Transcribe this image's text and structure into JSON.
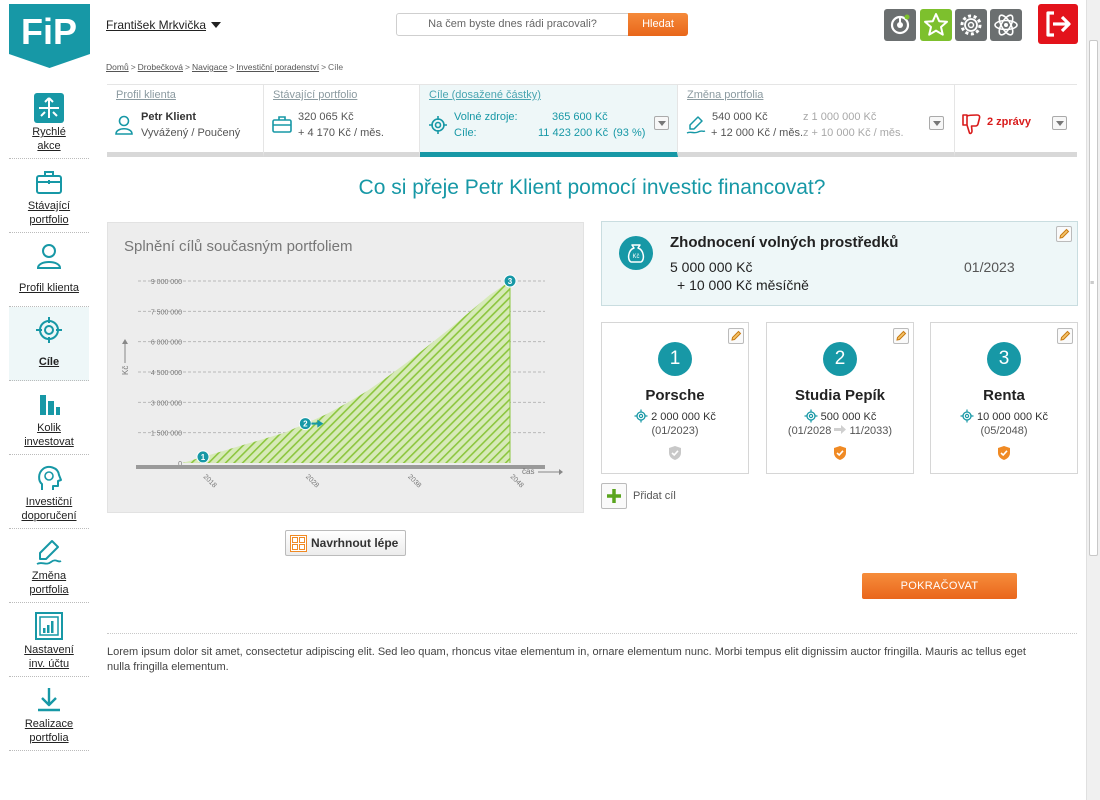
{
  "logo": {
    "text": "FiP"
  },
  "user": {
    "name": "František Mrkvička"
  },
  "search": {
    "placeholder": "Na čem byste dnes rádi pracovali?",
    "button_label": "Hledat"
  },
  "toolbar": {
    "icons": [
      "badge-icon",
      "star-icon",
      "gear-icon",
      "atom-icon",
      "logout-icon"
    ]
  },
  "breadcrumb": {
    "items": [
      "Domů",
      "Drobečková",
      "Navigace",
      "Investiční poradenství"
    ],
    "current": "Cíle",
    "separator": ">"
  },
  "sidebar": {
    "items": [
      {
        "label": "Rychlé akce",
        "line1": "Rychlé",
        "line2": "akce"
      },
      {
        "label": "Stávající portfolio",
        "line1": "Stávající",
        "line2": "portfolio"
      },
      {
        "label": "Profil klienta",
        "line1": "Profil klienta",
        "line2": ""
      },
      {
        "label": "Cíle",
        "line1": "Cíle",
        "line2": "",
        "active": true
      },
      {
        "label": "Kolik investovat",
        "line1": "Kolik",
        "line2": "investovat"
      },
      {
        "label": "Investiční doporučení",
        "line1": "Investiční",
        "line2": "doporučení"
      },
      {
        "label": "Změna portfolia",
        "line1": "Změna",
        "line2": "portfolia"
      },
      {
        "label": "Nastavení inv. účtu",
        "line1": "Nastavení",
        "line2": "inv. účtu"
      },
      {
        "label": "Realizace portfolia",
        "line1": "Realizace",
        "line2": "portfolia"
      }
    ]
  },
  "tabs": {
    "profile": {
      "title": "Profil klienta",
      "name": "Petr Klient",
      "profile": "Vyvážený / Poučený"
    },
    "portfolio": {
      "title": "Stávající portfolio",
      "amount": "320 065 Kč",
      "monthly": "+ 4 170 Kč / měs."
    },
    "goals": {
      "title": "Cíle (dosažené částky)",
      "free_label": "Volné zdroje:",
      "free_value": "365 600 Kč",
      "goals_label": "Cíle:",
      "goals_value": "11 423 200 Kč",
      "goals_pct": "(93 %)"
    },
    "change": {
      "title": "Změna portfolia",
      "amount": "540 000 Kč",
      "amount_of": "z 1 000 000 Kč",
      "monthly": "+ 12 000 Kč / měs.",
      "monthly_of": "z  + 10 000 Kč / měs."
    },
    "messages": {
      "label": "2 zprávy"
    }
  },
  "page_title": "Co si přeje Petr Klient pomocí investic financovat?",
  "chart_data": {
    "type": "area",
    "title": "Splnění cílů současným portfoliem",
    "xlabel": "čas",
    "ylabel": "Kč",
    "x_ticks": [
      "2018",
      "2028",
      "2038",
      "2048"
    ],
    "y_ticks": [
      "0",
      "1 500 000",
      "3 000 000",
      "4 500 000",
      "6 000 000",
      "7 500 000",
      "9 000 000"
    ],
    "ylim": [
      0,
      9000000
    ],
    "xlim": [
      2018,
      2048
    ],
    "x": [
      2016,
      2018,
      2020,
      2022,
      2024,
      2026,
      2028,
      2030,
      2032,
      2034,
      2036,
      2038,
      2040,
      2042,
      2044,
      2046,
      2048
    ],
    "values": [
      0,
      300000,
      600000,
      900000,
      1200000,
      1500000,
      1950000,
      2400000,
      2950000,
      3550000,
      4250000,
      5000000,
      5800000,
      6600000,
      7450000,
      8300000,
      9000000
    ],
    "markers": [
      {
        "label": "1",
        "x": 2018,
        "y": 300000
      },
      {
        "label": "2",
        "x": 2028,
        "y": 1950000
      },
      {
        "label": "3",
        "x": 2048,
        "y": 9000000
      }
    ],
    "fill_color": "#8cc63e",
    "marker_color": "#1798a6",
    "grid": true
  },
  "suggest_button": {
    "label": "Navrhnout lépe"
  },
  "free_funds": {
    "title": "Zhodnocení volných prostředků",
    "amount": "5 000 000 Kč",
    "monthly": "+ 10 000 Kč měsíčně",
    "date": "01/2023"
  },
  "goals": [
    {
      "number": "1",
      "name": "Porsche",
      "amount": "2 000 000 Kč",
      "date": "(01/2023)",
      "shield_color": "#c8c8c8"
    },
    {
      "number": "2",
      "name": "Studia Pepík",
      "amount": "500 000 Kč",
      "date_from": "(01/2028",
      "date_to": "11/2033)",
      "shield_color": "#f08a24"
    },
    {
      "number": "3",
      "name": "Renta",
      "amount": "10 000 000 Kč",
      "date": "(05/2048)",
      "shield_color": "#f08a24"
    }
  ],
  "add_goal": {
    "label": "Přidat cíl"
  },
  "continue_button": {
    "label": "POKRAČOVAT"
  },
  "footer": {
    "text": "Lorem ipsum dolor sit amet, consectetur adipiscing elit. Sed leo quam, rhoncus vitae elementum in, ornare elementum nunc. Morbi tempus elit dignissim auctor fringilla. Mauris ac tellus eget nulla fringilla elementum."
  },
  "colors": {
    "accent": "#1798a6",
    "orange": "#e9661c",
    "green": "#7dc02d",
    "red": "#e3131b"
  }
}
